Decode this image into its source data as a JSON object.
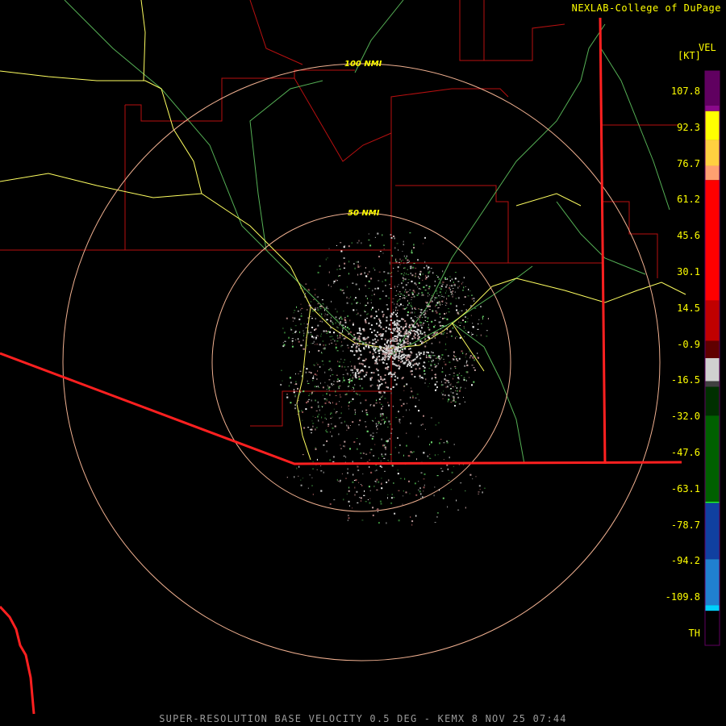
{
  "credit": "NEXLAB-College of DuPage",
  "footer": "SUPER-RESOLUTION BASE VELOCITY 0.5 DEG - KEMX 8 NOV 25 07:44",
  "legend": {
    "title": "VEL",
    "unit": "[KT]",
    "labels": [
      "107.8",
      "92.3",
      "76.7",
      "61.2",
      "45.6",
      "30.1",
      "14.5",
      "-0.9",
      "-16.5",
      "-32.0",
      "-47.6",
      "-63.1",
      "-78.7",
      "-94.2",
      "-109.8",
      "TH"
    ]
  },
  "range_rings": [
    {
      "label": "100 NMI"
    },
    {
      "label": "50 NMI"
    }
  ],
  "colors": {
    "state_border": "#ff2020",
    "county": "#c01010",
    "highway": "#ffff60",
    "river": "#50b050",
    "ring": "#f0b090",
    "legend_text": "#ffff00"
  }
}
